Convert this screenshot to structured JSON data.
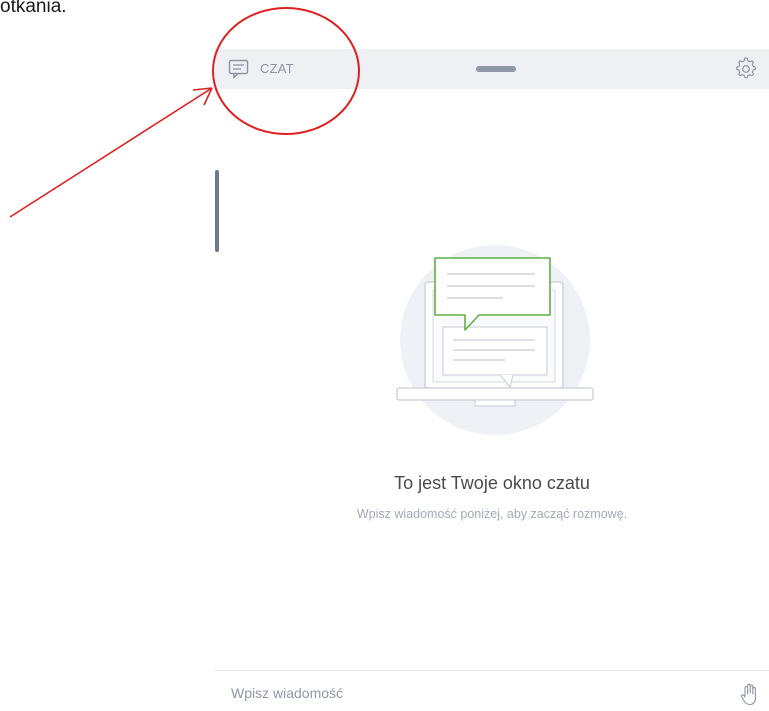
{
  "document": {
    "visible_text": "otkania."
  },
  "chat_panel": {
    "header": {
      "title": "CZAT",
      "chat_icon": "chat-icon",
      "settings_icon": "gear-icon"
    },
    "empty_state": {
      "title": "To jest Twoje okno czatu",
      "subtitle": "Wpisz wiadomość poniżej, aby zacząć rozmowę."
    },
    "input": {
      "placeholder": "Wpisz wiadomość",
      "value": "",
      "raise_hand_icon": "hand-icon"
    }
  },
  "colors": {
    "header_bg": "#eef0f4",
    "accent_green": "#5fb043",
    "annotation_red": "#e02020",
    "muted_text": "#8c95a3"
  }
}
